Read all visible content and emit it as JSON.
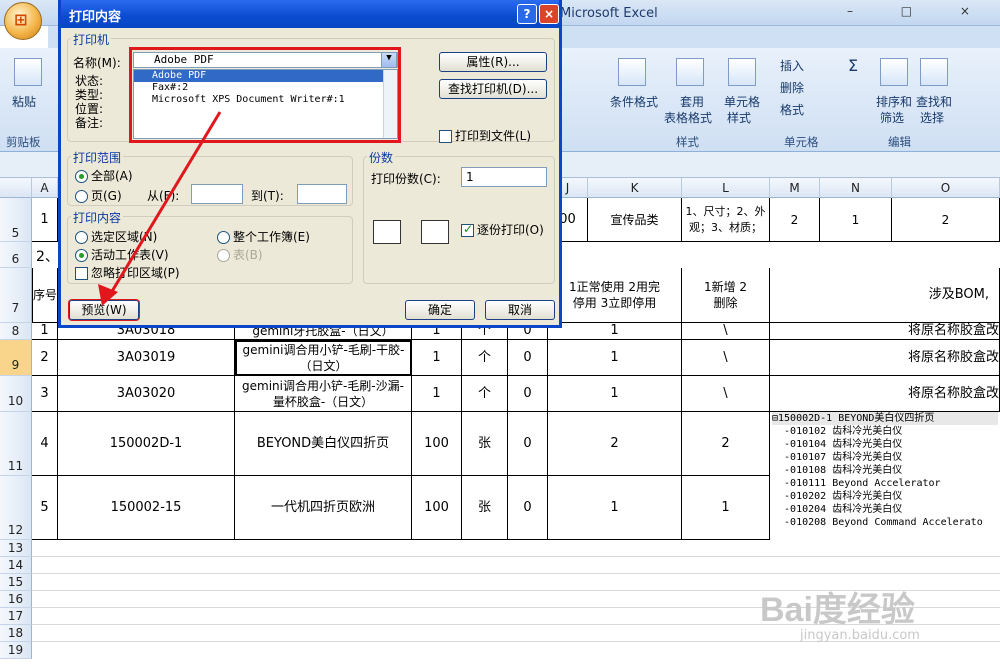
{
  "app": {
    "title": "Microsoft Excel",
    "window_buttons": "– □ ×",
    "help": "? – □ ×"
  },
  "ribbon": {
    "paste": "粘贴",
    "clipboard": "剪贴板",
    "cond_format": "条件格式",
    "table_format_1": "套用",
    "table_format_2": "表格格式",
    "cell_style_1": "单元格",
    "cell_style_2": "样式",
    "styles_group": "样式",
    "insert": "插入",
    "delete": "删除",
    "format": "格式",
    "cells_group": "单元格",
    "sort_1": "排序和",
    "sort_2": "筛选",
    "find_1": "查找和",
    "find_2": "选择",
    "edit_group": "编辑",
    "sigma": "Σ"
  },
  "dialog": {
    "title": "打印内容",
    "printer_section": "打印机",
    "name_label": "名称(M):",
    "status_label": "状态:",
    "type_label": "类型:",
    "location_label": "位置:",
    "comment_label": "备注:",
    "selected_printer": "Adobe PDF",
    "printers": [
      "Adobe PDF",
      "Fax#:2",
      "Microsoft XPS Document Writer#:1"
    ],
    "properties_btn": "属性(R)...",
    "find_printer_btn": "查找打印机(D)...",
    "print_to_file": "打印到文件(L)",
    "range_section": "打印范围",
    "all": "全部(A)",
    "pages": "页(G)",
    "from": "从(F):",
    "to": "到(T):",
    "copies_section": "份数",
    "copies_label": "打印份数(C):",
    "copies_value": "1",
    "collate": "逐份打印(O)",
    "content_section": "打印内容",
    "selection": "选定区域(N)",
    "workbook": "整个工作簿(E)",
    "active_sheet": "活动工作表(V)",
    "table": "表(B)",
    "ignore_area": "忽略打印区域(P)",
    "preview_btn": "预览(W)",
    "ok_btn": "确定",
    "cancel_btn": "取消"
  },
  "sheet": {
    "columns": [
      "A",
      "J",
      "K",
      "L",
      "M",
      "N",
      "O"
    ],
    "row_numbers": [
      "5",
      "6",
      "7",
      "8",
      "9",
      "10",
      "11",
      "12",
      "13",
      "14",
      "15",
      "16",
      "17",
      "18",
      "19"
    ],
    "row5": {
      "a": "1",
      "j": "00",
      "k": "宣传品类",
      "l": "1、尺寸；2、外观；3、材质；",
      "m": "2",
      "n": "1",
      "o": "2"
    },
    "row6": {
      "a": "2、"
    },
    "row7": {
      "a": "序号",
      "j": "1正常使用 2用完停用 3立即停用",
      "l": "1新增 2删除",
      "o": "涉及BOM,"
    },
    "rows": [
      {
        "a": "1",
        "code": "3A03018",
        "name": "gemini牙托胶盒-（日文）",
        "qty": "1",
        "unit": "个",
        "z": "0",
        "k": "1",
        "l": "\\",
        "o": "将原名称胶盒改"
      },
      {
        "a": "2",
        "code": "3A03019",
        "name": "gemini调合用小铲-毛刷-干胶-（日文）",
        "qty": "1",
        "unit": "个",
        "z": "0",
        "k": "1",
        "l": "\\",
        "o": "将原名称胶盒改"
      },
      {
        "a": "3",
        "code": "3A03020",
        "name": "gemini调合用小铲-毛刷-沙漏-量杯胶盒-（日文）",
        "qty": "1",
        "unit": "个",
        "z": "0",
        "k": "1",
        "l": "\\",
        "o": "将原名称胶盒改"
      },
      {
        "a": "4",
        "code": "150002D-1",
        "name": "BEYOND美白仪四折页",
        "qty": "100",
        "unit": "张",
        "z": "0",
        "k": "2",
        "l": "2",
        "o": ""
      },
      {
        "a": "5",
        "code": "150002-15",
        "name": "一代机四折页欧洲",
        "qty": "100",
        "unit": "张",
        "z": "0",
        "k": "1",
        "l": "1",
        "o": ""
      }
    ],
    "tree": [
      "⊟150002D-1 BEYOND美白仪四折页",
      "  -010102 齿科冷光美白仪",
      "  -010104 齿科冷光美白仪",
      "  -010107 齿科冷光美白仪",
      "  -010108 齿科冷光美白仪",
      "  -010111 Beyond Accelerator",
      "  -010202 齿科冷光美白仪",
      "  -010204 齿科冷光美白仪",
      "  -010208 Beyond Command Accelerato"
    ]
  },
  "watermark": {
    "logo": "Bai度经验",
    "url": "jingyan.baidu.com"
  },
  "colors": {
    "highlight": "#e0181e",
    "dialog_blue": "#0a47c8"
  }
}
